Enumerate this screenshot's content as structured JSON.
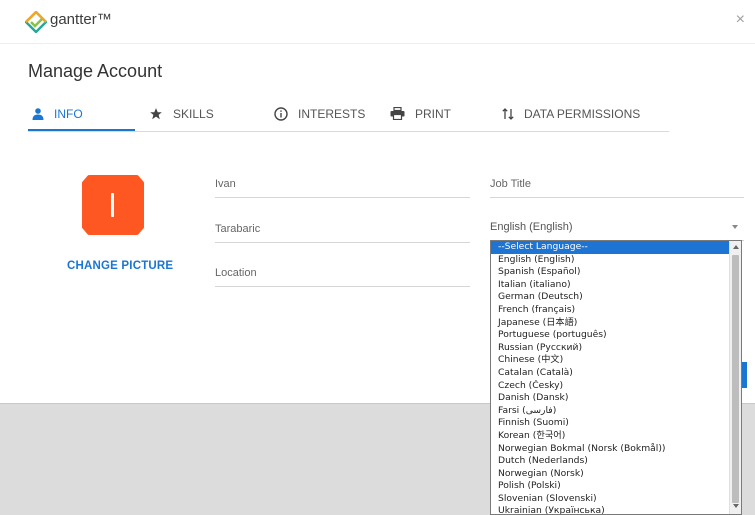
{
  "brand": {
    "name": "gantter™"
  },
  "header": {
    "close_symbol": "×"
  },
  "page": {
    "title": "Manage Account"
  },
  "tabs": [
    {
      "label": "INFO",
      "icon": "person-icon"
    },
    {
      "label": "SKILLS",
      "icon": "star-icon"
    },
    {
      "label": "INTERESTS",
      "icon": "info-icon"
    },
    {
      "label": "PRINT",
      "icon": "printer-icon"
    },
    {
      "label": "DATA PERMISSIONS",
      "icon": "sort-arrows-icon"
    }
  ],
  "profile": {
    "avatar_letter": "I",
    "change_picture_label": "CHANGE PICTURE",
    "first_name": "Ivan",
    "last_name": "Tarabaric",
    "location_placeholder": "Location",
    "job_title_placeholder": "Job Title",
    "language_value": "English (English)"
  },
  "language_dropdown": {
    "options": [
      "--Select Language--",
      "English (English)",
      "Spanish (Español)",
      "Italian (italiano)",
      "German (Deutsch)",
      "French (français)",
      "Japanese (日本語)",
      "Portuguese (português)",
      "Russian (Русский)",
      "Chinese (中文)",
      "Catalan (Català)",
      "Czech (Česky)",
      "Danish (Dansk)",
      "Farsi (فارسی)",
      "Finnish (Suomi)",
      "Korean (한국어)",
      "Norwegian Bokmal (Norsk (Bokmål))",
      "Dutch (Nederlands)",
      "Norwegian (Norsk)",
      "Polish (Polski)",
      "Slovenian (Slovenski)",
      "Ukrainian (Українська)"
    ],
    "highlighted_index": 0
  },
  "colors": {
    "accent": "#1976d2",
    "avatar": "#ff5722",
    "logo_orange": "#f5a623",
    "logo_green": "#8bc34a",
    "logo_teal": "#26a69a"
  }
}
